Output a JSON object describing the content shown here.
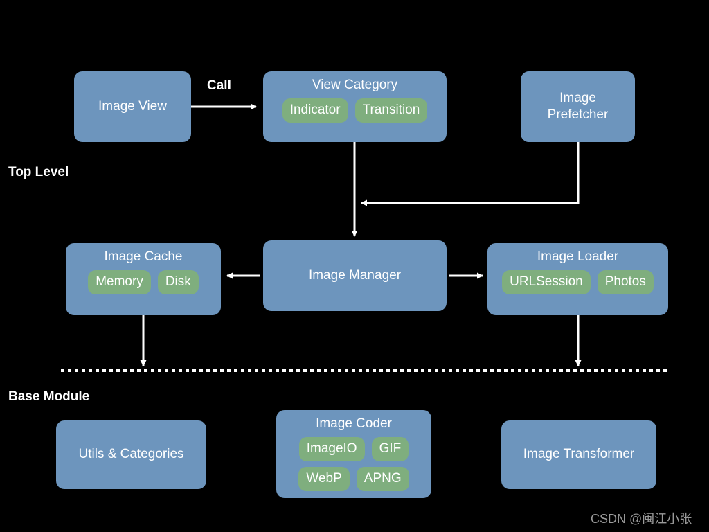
{
  "diagram": {
    "title_watermark": "CSDN @闽江小张",
    "colors": {
      "background": "#000000",
      "node_blue": "#6d95bd",
      "chip_green": "#7fae7e",
      "edge_white": "#ffffff",
      "label_white": "#ffffff",
      "watermark_gray": "#9a9a9a"
    },
    "sections": [
      {
        "id": "top-level",
        "label": "Top Level"
      },
      {
        "id": "base-module",
        "label": "Base Module"
      }
    ],
    "edge_labels": [
      {
        "id": "call",
        "label": "Call"
      }
    ],
    "nodes": [
      {
        "id": "image-view",
        "title": "Image View",
        "chips": []
      },
      {
        "id": "view-category",
        "title": "View Category",
        "chips": [
          "Indicator",
          "Transition"
        ]
      },
      {
        "id": "image-prefetcher",
        "title": "Image\nPrefetcher",
        "title_line1": "Image",
        "title_line2": "Prefetcher",
        "chips": []
      },
      {
        "id": "image-cache",
        "title": "Image Cache",
        "chips": [
          "Memory",
          "Disk"
        ]
      },
      {
        "id": "image-manager",
        "title": "Image Manager",
        "chips": []
      },
      {
        "id": "image-loader",
        "title": "Image Loader",
        "chips": [
          "URLSession",
          "Photos"
        ]
      },
      {
        "id": "utils-categories",
        "title": "Utils & Categories",
        "chips": []
      },
      {
        "id": "image-coder",
        "title": "Image Coder",
        "chips": [
          "ImageIO",
          "GIF",
          "WebP",
          "APNG"
        ]
      },
      {
        "id": "image-transformer",
        "title": "Image Transformer",
        "chips": []
      }
    ],
    "edges": [
      {
        "id": "image-view-to-view-category",
        "from": "image-view",
        "to": "view-category",
        "label": "Call",
        "style": "solid-arrow"
      },
      {
        "id": "view-category-to-image-manager",
        "from": "view-category",
        "to": "image-manager",
        "label": "",
        "style": "solid-arrow"
      },
      {
        "id": "image-prefetcher-to-image-manager",
        "from": "image-prefetcher",
        "to": "image-manager",
        "label": "",
        "style": "elbow-arrow"
      },
      {
        "id": "image-manager-to-image-cache",
        "from": "image-manager",
        "to": "image-cache",
        "label": "",
        "style": "solid-arrow"
      },
      {
        "id": "image-manager-to-image-loader",
        "from": "image-manager",
        "to": "image-loader",
        "label": "",
        "style": "solid-arrow"
      },
      {
        "id": "image-cache-to-base-module",
        "from": "image-cache",
        "to": "base-module",
        "label": "",
        "style": "solid-arrow"
      },
      {
        "id": "image-loader-to-base-module",
        "from": "image-loader",
        "to": "base-module",
        "label": "",
        "style": "solid-arrow"
      }
    ]
  }
}
